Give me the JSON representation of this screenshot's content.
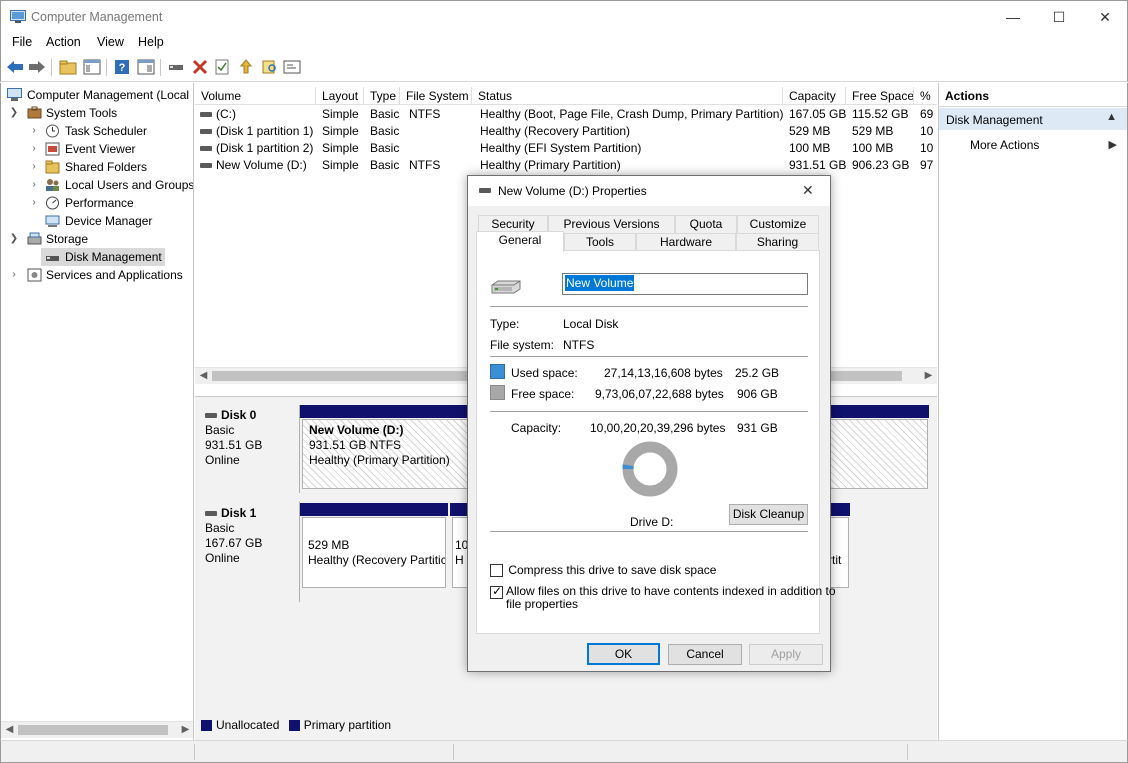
{
  "window": {
    "title": "Computer Management",
    "min_label": "—",
    "max_label": "☐",
    "close_label": "✕"
  },
  "menu": [
    "File",
    "Action",
    "View",
    "Help"
  ],
  "toolbar_icons": [
    "back-arrow-icon",
    "forward-arrow-icon",
    "up-folder-icon",
    "show-hide-tree-icon",
    "help-icon",
    "properties-pane-icon",
    "connect-icon",
    "delete-icon",
    "check-icon",
    "export-icon",
    "search-icon",
    "rescan-icon"
  ],
  "tree": {
    "root": "Computer Management (Local",
    "system_tools": "System Tools",
    "task_scheduler": "Task Scheduler",
    "event_viewer": "Event Viewer",
    "shared_folders": "Shared Folders",
    "local_users": "Local Users and Groups",
    "performance": "Performance",
    "device_manager": "Device Manager",
    "storage": "Storage",
    "disk_management": "Disk Management",
    "services": "Services and Applications"
  },
  "volumes": {
    "headers": [
      "Volume",
      "Layout",
      "Type",
      "File System",
      "Status",
      "Capacity",
      "Free Space",
      "%"
    ],
    "rows": [
      [
        "(C:)",
        "Simple",
        "Basic",
        "NTFS",
        "Healthy (Boot, Page File, Crash Dump, Primary Partition)",
        "167.05 GB",
        "115.52 GB",
        "69"
      ],
      [
        "(Disk 1 partition 1)",
        "Simple",
        "Basic",
        "",
        "Healthy (Recovery Partition)",
        "529 MB",
        "529 MB",
        "10"
      ],
      [
        "(Disk 1 partition 2)",
        "Simple",
        "Basic",
        "",
        "Healthy (EFI System Partition)",
        "100 MB",
        "100 MB",
        "10"
      ],
      [
        "New Volume (D:)",
        "Simple",
        "Basic",
        "NTFS",
        "Healthy (Primary Partition)",
        "931.51 GB",
        "906.23 GB",
        "97"
      ]
    ]
  },
  "disks": {
    "disk0": {
      "name": "Disk 0",
      "type": "Basic",
      "size": "931.51 GB",
      "state": "Online",
      "partition": {
        "name": "New Volume  (D:)",
        "size": "931.51 GB NTFS",
        "status": "Healthy (Primary Partition)"
      }
    },
    "disk1": {
      "name": "Disk 1",
      "type": "Basic",
      "size": "167.67 GB",
      "state": "Online",
      "p1": {
        "size": "529 MB",
        "status": "Healthy (Recovery Partitic"
      },
      "p2": {
        "size": "10",
        "status": "H"
      },
      "p3": {
        "status": "rtit"
      }
    }
  },
  "legend": {
    "unallocated": "Unallocated",
    "primary": "Primary partition"
  },
  "actions": {
    "header": "Actions",
    "section": "Disk Management",
    "more": "More Actions"
  },
  "dialog": {
    "title": "New Volume (D:) Properties",
    "close_label": "✕",
    "tabs_row1": [
      "Security",
      "Previous Versions",
      "Quota",
      "Customize"
    ],
    "tabs_row2": [
      "General",
      "Tools",
      "Hardware",
      "Sharing"
    ],
    "volume_name": "New Volume",
    "type_label": "Type:",
    "type_value": "Local Disk",
    "fs_label": "File system:",
    "fs_value": "NTFS",
    "used_label": "Used space:",
    "used_bytes": "27,14,13,16,608 bytes",
    "used_gb": "25.2 GB",
    "free_label": "Free space:",
    "free_bytes": "9,73,06,07,22,688 bytes",
    "free_gb": "906 GB",
    "cap_label": "Capacity:",
    "cap_bytes": "10,00,20,20,39,296 bytes",
    "cap_gb": "931 GB",
    "used_fraction": 0.027,
    "used_color": "#3c8fd6",
    "free_color": "#a8a8a8",
    "drive_label": "Drive D:",
    "cleanup_label": "Disk Cleanup",
    "compress_label": "Compress this drive to save disk space",
    "compress_checked": false,
    "index_label_1": "Allow files on this drive to have contents indexed in addition to",
    "index_label_2": "file properties",
    "index_checked": true,
    "ok_label": "OK",
    "cancel_label": "Cancel",
    "apply_label": "Apply"
  }
}
